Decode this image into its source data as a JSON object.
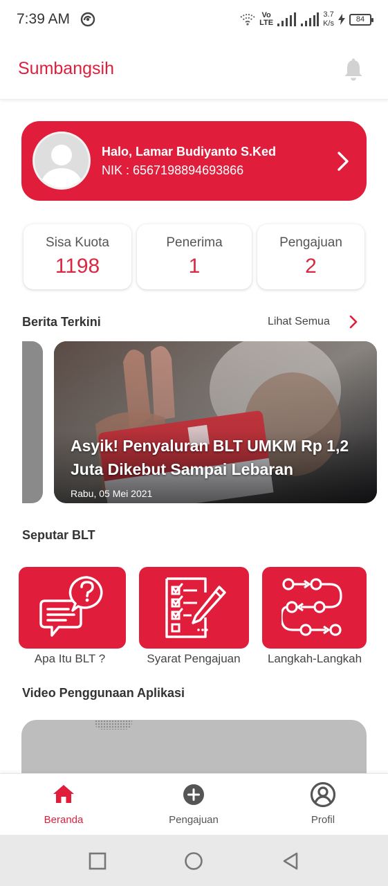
{
  "status_bar": {
    "time": "7:39 AM",
    "network_top": "Vo",
    "network_bottom": "LTE",
    "speed_value": "3.7",
    "speed_unit": "K/s",
    "battery": "84"
  },
  "header": {
    "title": "Sumbangsih",
    "icon": "bell-icon"
  },
  "profile": {
    "greeting": "Halo, Lamar Budiyanto S.Ked",
    "nik": "NIK : 6567198894693866"
  },
  "stats": [
    {
      "label": "Sisa Kuota",
      "value": "1198"
    },
    {
      "label": "Penerima",
      "value": "1"
    },
    {
      "label": "Pengajuan",
      "value": "2"
    }
  ],
  "news_section": {
    "title": "Berita Terkini",
    "see_all": "Lihat Semua",
    "article": {
      "title": "Asyik! Penyaluran BLT UMKM Rp 1,2 Juta Dikebut Sampai Lebaran",
      "date": "Rabu, 05 Mei 2021"
    }
  },
  "blt_section": {
    "title": "Seputar BLT",
    "tiles": [
      {
        "label": "Apa Itu BLT ?",
        "icon": "question-chat-icon"
      },
      {
        "label": "Syarat Pengajuan",
        "icon": "checklist-pencil-icon"
      },
      {
        "label": "Langkah-Langkah",
        "icon": "steps-flow-icon"
      }
    ]
  },
  "video_section": {
    "title": "Video Penggunaan Aplikasi"
  },
  "bottom_nav": [
    {
      "label": "Beranda",
      "icon": "home-icon",
      "active": true
    },
    {
      "label": "Pengajuan",
      "icon": "plus-circle-icon",
      "active": false
    },
    {
      "label": "Profil",
      "icon": "profile-icon",
      "active": false
    }
  ],
  "colors": {
    "primary": "#e01e3c",
    "stat_value": "#d9283f",
    "nav_inactive": "#555555"
  }
}
